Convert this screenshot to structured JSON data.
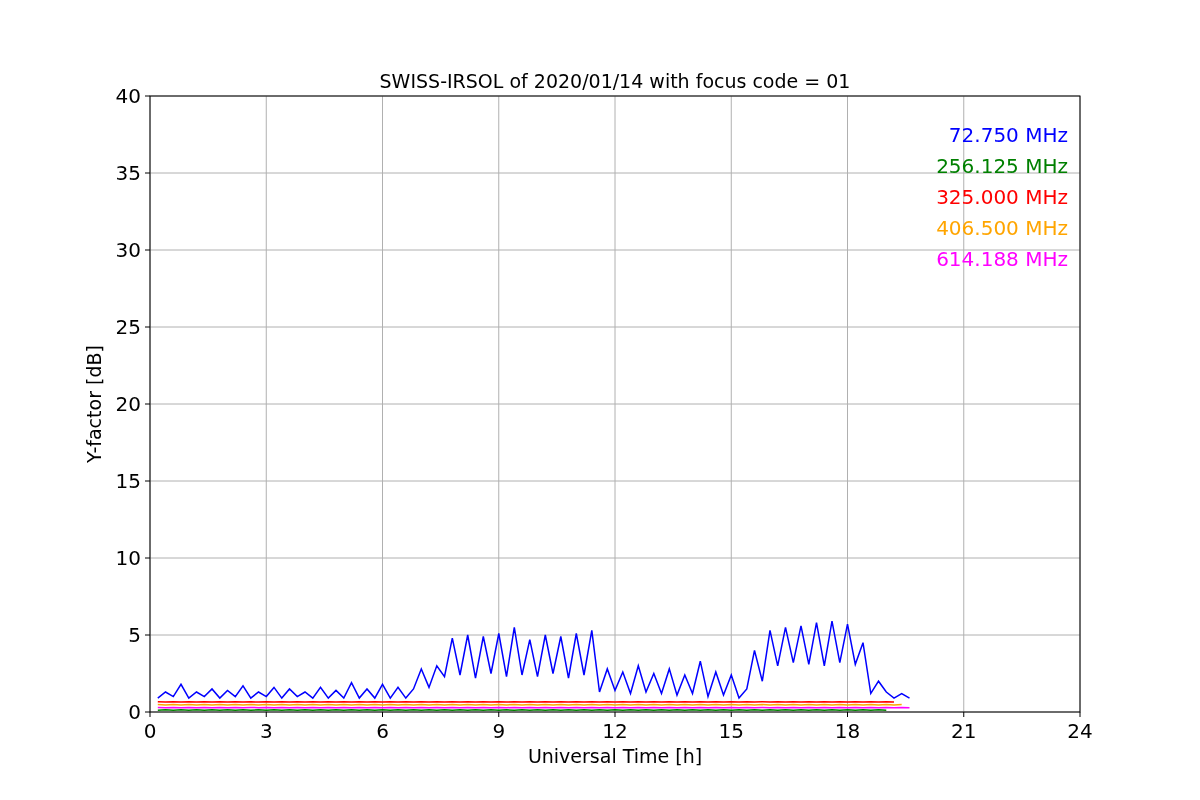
{
  "chart_data": {
    "type": "line",
    "title": "SWISS-IRSOL of 2020/01/14 with focus code = 01",
    "xlabel": "Universal Time [h]",
    "ylabel": "Y-factor [dB]",
    "grid": true,
    "x": [
      0.2,
      0.4,
      0.6,
      0.8,
      1.0,
      1.2,
      1.4,
      1.6,
      1.8,
      2.0,
      2.2,
      2.4,
      2.6,
      2.8,
      3.0,
      3.2,
      3.4,
      3.6,
      3.8,
      4.0,
      4.2,
      4.4,
      4.6,
      4.8,
      5.0,
      5.2,
      5.4,
      5.6,
      5.8,
      6.0,
      6.2,
      6.4,
      6.6,
      6.8,
      7.0,
      7.2,
      7.4,
      7.6,
      7.8,
      8.0,
      8.2,
      8.4,
      8.6,
      8.8,
      9.0,
      9.2,
      9.4,
      9.6,
      9.8,
      10.0,
      10.2,
      10.4,
      10.6,
      10.8,
      11.0,
      11.2,
      11.4,
      11.6,
      11.8,
      12.0,
      12.2,
      12.4,
      12.6,
      12.8,
      13.0,
      13.2,
      13.4,
      13.6,
      13.8,
      14.0,
      14.2,
      14.4,
      14.6,
      14.8,
      15.0,
      15.2,
      15.4,
      15.6,
      15.8,
      16.0,
      16.2,
      16.4,
      16.6,
      16.8,
      17.0,
      17.2,
      17.4,
      17.6,
      17.8,
      18.0,
      18.2,
      18.4,
      18.6,
      18.8,
      19.0,
      19.2,
      19.4,
      19.6
    ],
    "series": [
      {
        "name": "72.750 MHz",
        "color": "#0000ff",
        "values": [
          0.9,
          1.3,
          1.0,
          1.8,
          0.9,
          1.3,
          1.0,
          1.5,
          0.9,
          1.4,
          1.0,
          1.7,
          0.9,
          1.3,
          1.0,
          1.6,
          0.9,
          1.5,
          1.0,
          1.3,
          0.9,
          1.6,
          0.9,
          1.4,
          0.9,
          1.9,
          0.9,
          1.5,
          0.9,
          1.8,
          0.9,
          1.6,
          0.9,
          1.5,
          2.8,
          1.6,
          3.0,
          2.3,
          4.8,
          2.4,
          5.0,
          2.2,
          4.9,
          2.5,
          5.1,
          2.3,
          5.5,
          2.4,
          4.7,
          2.3,
          5.0,
          2.5,
          4.9,
          2.2,
          5.1,
          2.4,
          5.3,
          1.3,
          2.8,
          1.4,
          2.6,
          1.2,
          3.0,
          1.3,
          2.5,
          1.2,
          2.8,
          1.1,
          2.4,
          1.2,
          3.3,
          1.0,
          2.6,
          1.1,
          2.4,
          0.9,
          1.5,
          4.0,
          2.0,
          5.3,
          3.0,
          5.5,
          3.2,
          5.6,
          3.1,
          5.8,
          3.0,
          5.9,
          3.2,
          5.7,
          3.1,
          4.5,
          1.2,
          2.0,
          1.3,
          0.9,
          1.2,
          0.9
        ]
      },
      {
        "name": "256.125 MHz",
        "color": "#008000",
        "values": [
          0.12,
          0.14,
          0.12,
          0.14,
          0.12,
          0.14,
          0.12,
          0.14,
          0.12,
          0.14,
          0.12,
          0.14,
          0.12,
          0.14,
          0.12,
          0.14,
          0.12,
          0.14,
          0.12,
          0.14,
          0.12,
          0.14,
          0.12,
          0.14,
          0.12,
          0.14,
          0.12,
          0.14,
          0.12,
          0.14,
          0.12,
          0.14,
          0.12,
          0.14,
          0.12,
          0.14,
          0.12,
          0.14,
          0.12,
          0.14,
          0.12,
          0.14,
          0.12,
          0.14,
          0.12,
          0.14,
          0.12,
          0.14,
          0.12,
          0.14,
          0.12,
          0.14,
          0.12,
          0.14,
          0.12,
          0.14,
          0.12,
          0.14,
          0.12,
          0.14,
          0.12,
          0.14,
          0.12,
          0.14,
          0.12,
          0.14,
          0.12,
          0.14,
          0.12,
          0.14,
          0.12,
          0.14,
          0.12,
          0.14,
          0.12,
          0.14,
          0.12,
          0.14,
          0.12,
          0.14,
          0.12,
          0.14,
          0.12,
          0.14,
          0.12,
          0.14,
          0.12,
          0.14,
          0.12,
          0.14,
          0.12,
          0.14,
          0.12,
          0.14,
          0.12,
          null,
          null,
          null
        ]
      },
      {
        "name": "325.000 MHz",
        "color": "#ff0000",
        "values": [
          0.66,
          0.64,
          0.66,
          0.64,
          0.66,
          0.64,
          0.66,
          0.64,
          0.66,
          0.64,
          0.66,
          0.64,
          0.66,
          0.64,
          0.66,
          0.64,
          0.66,
          0.64,
          0.66,
          0.64,
          0.66,
          0.64,
          0.66,
          0.64,
          0.66,
          0.64,
          0.66,
          0.64,
          0.66,
          0.64,
          0.66,
          0.64,
          0.66,
          0.64,
          0.66,
          0.64,
          0.66,
          0.64,
          0.66,
          0.64,
          0.66,
          0.64,
          0.66,
          0.64,
          0.66,
          0.64,
          0.66,
          0.64,
          0.66,
          0.64,
          0.66,
          0.64,
          0.66,
          0.64,
          0.66,
          0.64,
          0.66,
          0.64,
          0.66,
          0.64,
          0.66,
          0.64,
          0.66,
          0.64,
          0.66,
          0.64,
          0.66,
          0.64,
          0.66,
          0.64,
          0.66,
          0.64,
          0.66,
          0.64,
          0.66,
          0.64,
          0.66,
          0.64,
          0.66,
          0.64,
          0.66,
          0.64,
          0.66,
          0.64,
          0.66,
          0.64,
          0.66,
          0.64,
          0.66,
          0.64,
          0.66,
          0.64,
          0.66,
          0.64,
          0.66,
          0.64,
          null,
          null
        ]
      },
      {
        "name": "406.500 MHz",
        "color": "#ffa500",
        "values": [
          0.48,
          0.46,
          0.48,
          0.46,
          0.48,
          0.46,
          0.48,
          0.46,
          0.48,
          0.46,
          0.48,
          0.46,
          0.48,
          0.46,
          0.48,
          0.46,
          0.48,
          0.46,
          0.48,
          0.46,
          0.48,
          0.46,
          0.48,
          0.46,
          0.48,
          0.46,
          0.48,
          0.46,
          0.48,
          0.46,
          0.48,
          0.46,
          0.48,
          0.46,
          0.48,
          0.46,
          0.48,
          0.46,
          0.48,
          0.46,
          0.48,
          0.46,
          0.48,
          0.46,
          0.48,
          0.46,
          0.48,
          0.46,
          0.48,
          0.46,
          0.48,
          0.46,
          0.48,
          0.46,
          0.48,
          0.46,
          0.48,
          0.46,
          0.48,
          0.46,
          0.48,
          0.46,
          0.48,
          0.46,
          0.48,
          0.46,
          0.48,
          0.46,
          0.48,
          0.46,
          0.48,
          0.46,
          0.48,
          0.46,
          0.48,
          0.46,
          0.48,
          0.46,
          0.48,
          0.46,
          0.48,
          0.46,
          0.48,
          0.46,
          0.48,
          0.46,
          0.48,
          0.46,
          0.48,
          0.46,
          0.48,
          0.46,
          0.48,
          0.46,
          0.48,
          0.46,
          0.48,
          null
        ]
      },
      {
        "name": "614.188 MHz",
        "color": "#ff00ff",
        "values": [
          0.3,
          0.28,
          0.3,
          0.28,
          0.3,
          0.28,
          0.3,
          0.28,
          0.3,
          0.28,
          0.3,
          0.28,
          0.3,
          0.28,
          0.3,
          0.28,
          0.3,
          0.28,
          0.3,
          0.28,
          0.3,
          0.28,
          0.3,
          0.28,
          0.3,
          0.28,
          0.3,
          0.28,
          0.3,
          0.28,
          0.3,
          0.28,
          0.3,
          0.28,
          0.3,
          0.28,
          0.3,
          0.28,
          0.3,
          0.28,
          0.3,
          0.28,
          0.3,
          0.28,
          0.3,
          0.28,
          0.3,
          0.28,
          0.3,
          0.28,
          0.3,
          0.28,
          0.3,
          0.28,
          0.3,
          0.28,
          0.3,
          0.28,
          0.3,
          0.28,
          0.3,
          0.28,
          0.3,
          0.28,
          0.3,
          0.28,
          0.3,
          0.28,
          0.3,
          0.28,
          0.3,
          0.28,
          0.3,
          0.28,
          0.3,
          0.28,
          0.3,
          0.28,
          0.3,
          0.28,
          0.3,
          0.28,
          0.3,
          0.28,
          0.3,
          0.28,
          0.3,
          0.28,
          0.3,
          0.28,
          0.3,
          0.28,
          0.3,
          0.28,
          0.3,
          0.28,
          0.3,
          0.28
        ]
      }
    ],
    "xlim": [
      0,
      24
    ],
    "ylim": [
      0,
      40
    ],
    "xticks": [
      0,
      3,
      6,
      9,
      12,
      15,
      18,
      21,
      24
    ],
    "yticks": [
      0,
      5,
      10,
      15,
      20,
      25,
      30,
      35,
      40
    ]
  }
}
